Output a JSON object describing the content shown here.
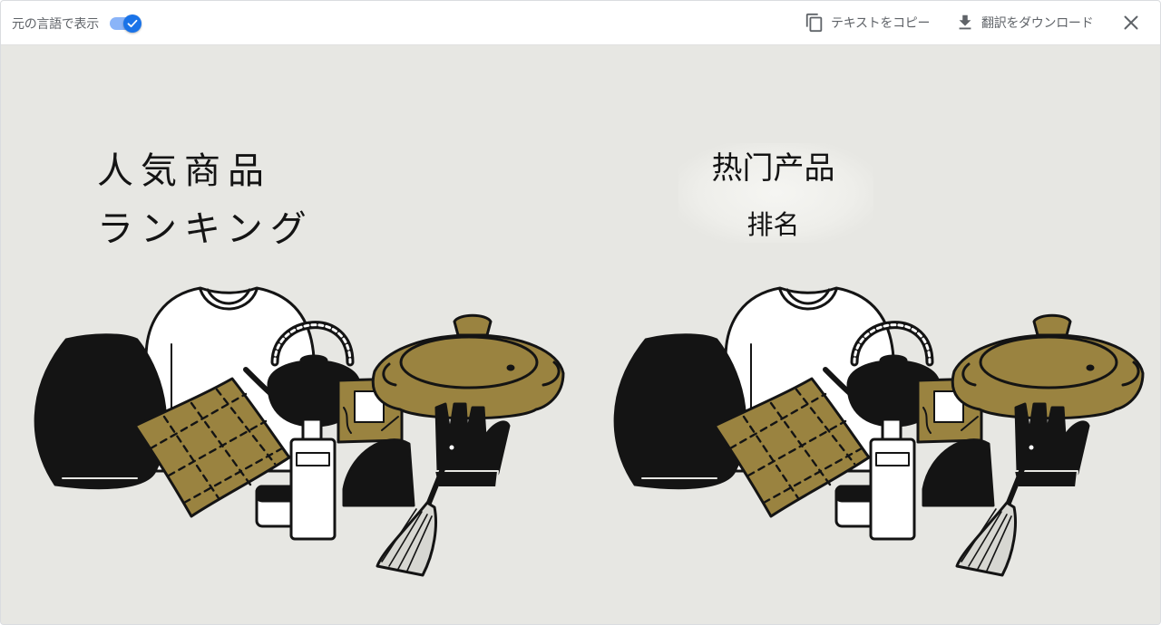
{
  "toolbar": {
    "show_original_label": "元の言語で表示",
    "show_original_enabled": true,
    "copy_text_label": "テキストをコピー",
    "download_label": "翻訳をダウンロード",
    "icons": {
      "toggle": "check-icon",
      "copy": "copy-icon",
      "download": "download-icon",
      "close": "close-icon"
    },
    "accent_color": "#1a73e8"
  },
  "original": {
    "title_line1": "人気商品",
    "title_line2": "ランキング"
  },
  "translated": {
    "title_line1": "热门产品",
    "title_line2": "排名"
  },
  "colors": {
    "background": "#e7e7e3",
    "ink": "#141414",
    "olive": "#9a8340"
  }
}
